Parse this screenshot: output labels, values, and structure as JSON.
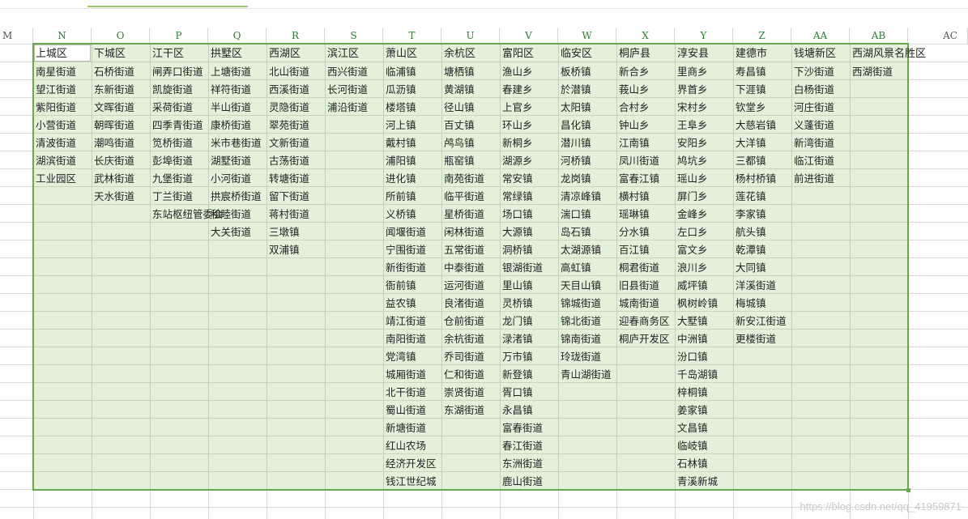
{
  "columns": [
    "M",
    "N",
    "O",
    "P",
    "Q",
    "R",
    "S",
    "T",
    "U",
    "V",
    "W",
    "X",
    "Y",
    "Z",
    "AA",
    "AB",
    "AC"
  ],
  "headers": [
    "上城区",
    "下城区",
    "江干区",
    "拱墅区",
    "西湖区",
    "滨江区",
    "萧山区",
    "余杭区",
    "富阳区",
    "临安区",
    "桐庐县",
    "淳安县",
    "建德市",
    "钱塘新区",
    "西湖风景名胜区"
  ],
  "data_columns": [
    [
      "南星街道",
      "望江街道",
      "紫阳街道",
      "小营街道",
      "清波街道",
      "湖滨街道",
      "工业园区"
    ],
    [
      "石桥街道",
      "东新街道",
      "文晖街道",
      "朝晖街道",
      "潮鸣街道",
      "长庆街道",
      "武林街道",
      "天水街道"
    ],
    [
      "闸弄口街道",
      "凯旋街道",
      "采荷街道",
      "四季青街道",
      "笕桥街道",
      "彭埠街道",
      "九堡街道",
      "丁兰街道",
      "东站枢纽管委会"
    ],
    [
      "上塘街道",
      "祥符街道",
      "半山街道",
      "康桥街道",
      "米市巷街道",
      "湖墅街道",
      "小河街道",
      "拱宸桥街道",
      "和睦街道",
      "大关街道"
    ],
    [
      "北山街道",
      "西溪街道",
      "灵隐街道",
      "翠苑街道",
      "文新街道",
      "古荡街道",
      "转塘街道",
      "留下街道",
      "蒋村街道",
      "三墩镇",
      "双浦镇"
    ],
    [
      "西兴街道",
      "长河街道",
      "浦沿街道"
    ],
    [
      "临浦镇",
      "瓜沥镇",
      "楼塔镇",
      "河上镇",
      "戴村镇",
      "浦阳镇",
      "进化镇",
      "所前镇",
      "义桥镇",
      "闻堰街道",
      "宁围街道",
      "新街街道",
      "衙前镇",
      "益农镇",
      "靖江街道",
      "南阳街道",
      "党湾镇",
      "城厢街道",
      "北干街道",
      "蜀山街道",
      "新塘街道",
      "红山农场",
      "经济开发区",
      "钱江世纪城"
    ],
    [
      "塘栖镇",
      "黄湖镇",
      "径山镇",
      "百丈镇",
      "鸬鸟镇",
      "瓶窑镇",
      "南苑街道",
      "临平街道",
      "星桥街道",
      "闲林街道",
      "五常街道",
      "中泰街道",
      "运河街道",
      "良渚街道",
      "仓前街道",
      "余杭街道",
      "乔司街道",
      "仁和街道",
      "崇贤街道",
      "东湖街道"
    ],
    [
      "渔山乡",
      "春建乡",
      "上官乡",
      "环山乡",
      "新桐乡",
      "湖源乡",
      "常安镇",
      "常绿镇",
      "场口镇",
      "大源镇",
      "洞桥镇",
      "银湖街道",
      "里山镇",
      "灵桥镇",
      "龙门镇",
      "渌渚镇",
      "万市镇",
      "新登镇",
      "胥口镇",
      "永昌镇",
      "富春街道",
      "春江街道",
      "东洲街道",
      "鹿山街道"
    ],
    [
      "板桥镇",
      "於潜镇",
      "太阳镇",
      "昌化镇",
      "潜川镇",
      "河桥镇",
      "龙岗镇",
      "清凉峰镇",
      "湍口镇",
      "岛石镇",
      "太湖源镇",
      "高虹镇",
      "天目山镇",
      "锦城街道",
      "锦北街道",
      "锦南街道",
      "玲珑街道",
      "青山湖街道"
    ],
    [
      "新合乡",
      "莪山乡",
      "合村乡",
      "钟山乡",
      "江南镇",
      "凤川街道",
      "富春江镇",
      "横村镇",
      "瑶琳镇",
      "分水镇",
      "百江镇",
      "桐君街道",
      "旧县街道",
      "城南街道",
      "迎春商务区",
      "桐庐开发区"
    ],
    [
      "里商乡",
      "界首乡",
      "宋村乡",
      "王阜乡",
      "安阳乡",
      "鸠坑乡",
      "瑶山乡",
      "屏门乡",
      "金峰乡",
      "左口乡",
      "富文乡",
      "浪川乡",
      "威坪镇",
      "枫树岭镇",
      "大墅镇",
      "中洲镇",
      "汾口镇",
      "千岛湖镇",
      "梓桐镇",
      "姜家镇",
      "文昌镇",
      "临岐镇",
      "石林镇",
      "青溪新城"
    ],
    [
      "寿昌镇",
      "下涯镇",
      "钦堂乡",
      "大慈岩镇",
      "大洋镇",
      "三都镇",
      "杨村桥镇",
      "莲花镇",
      "李家镇",
      "航头镇",
      "乾潭镇",
      "大同镇",
      "洋溪街道",
      "梅城镇",
      "新安江街道",
      "更楼街道"
    ],
    [
      "下沙街道",
      "白杨街道",
      "河庄街道",
      "义蓬街道",
      "新湾街道",
      "临江街道",
      "前进街道"
    ],
    [
      "西湖街道"
    ]
  ],
  "watermark": "https://blog.csdn.net/qq_41959871",
  "colors": {
    "selection_border": "#6aa84f",
    "selection_fill": "#d9edcc",
    "header_text": "#2e7d32"
  }
}
